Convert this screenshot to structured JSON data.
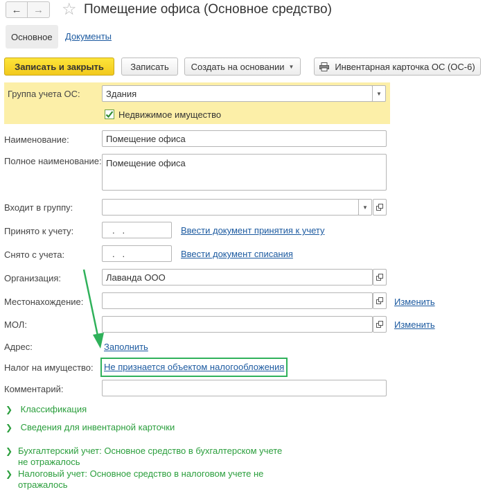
{
  "header": {
    "title": "Помещение офиса (Основное средство)"
  },
  "tabs": {
    "main": "Основное",
    "documents": "Документы"
  },
  "toolbar": {
    "save_close": "Записать и закрыть",
    "save": "Записать",
    "create_based": "Создать на основании",
    "inventory_card": "Инвентарная карточка ОС (ОС-6)"
  },
  "form": {
    "group_label": "Группа учета ОС:",
    "group_value": "Здания",
    "realty_checked": true,
    "realty_label": "Недвижимое имущество",
    "name_label": "Наименование:",
    "name_value": "Помещение офиса",
    "fullname_label": "Полное наименование:",
    "fullname_value": "Помещение офиса",
    "parent_label": "Входит в группу:",
    "parent_value": "",
    "accepted_label": "Принято к учету:",
    "accepted_value": ".   .",
    "accepted_link": "Ввести документ принятия к учету",
    "removed_label": "Снято с учета:",
    "removed_value": ".   .",
    "removed_link": "Ввести документ списания",
    "org_label": "Организация:",
    "org_value": "Лаванда ООО",
    "location_label": "Местонахождение:",
    "location_value": "",
    "location_link": "Изменить",
    "mol_label": "МОЛ:",
    "mol_value": "",
    "mol_link": "Изменить",
    "address_label": "Адрес:",
    "address_link": "Заполнить",
    "tax_label": "Налог на имущество:",
    "tax_link": "Не признается объектом налогообложения",
    "comment_label": "Комментарий:",
    "comment_value": ""
  },
  "sections": [
    {
      "line1": "Классификация",
      "line2": ""
    },
    {
      "line1": "Сведения для инвентарной карточки",
      "line2": ""
    },
    {
      "line1": "Бухгалтерский учет: Основное средство в бухгалтерском учете",
      "line2": "не отражалось"
    },
    {
      "line1": "Налоговый учет: Основное средство в налоговом учете не",
      "line2": "отражалось"
    }
  ],
  "colors": {
    "primary_button": "#f5d024",
    "group_panel": "#fcefa8",
    "link": "#1c5aa0",
    "section_text": "#2a9e3c",
    "annotation": "#2fb15a"
  }
}
